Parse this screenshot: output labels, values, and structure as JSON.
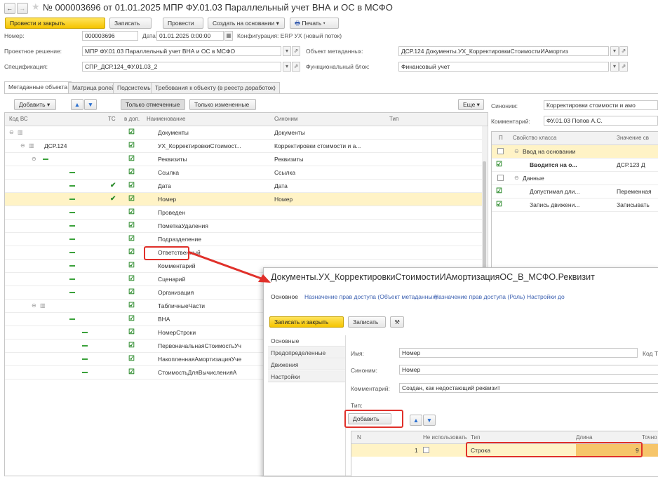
{
  "window": {
    "title": "№ 000003696 от 01.01.2025 МПР ФУ.01.03 Параллельный учет ВНА и ОС в МСФО",
    "nav_back": "←",
    "nav_forward": "→",
    "star": "★"
  },
  "toolbar": {
    "post_close": "Провести и закрыть",
    "save": "Записать",
    "post": "Провести",
    "create_based": "Создать на основании",
    "print": "Печать"
  },
  "header": {
    "number_label": "Номер:",
    "number_value": "000003696",
    "date_label": "Дата:",
    "date_value": "01.01.2025 0:00:00",
    "config_text": "Конфигурация: ERP УХ (новый поток)",
    "project_label": "Проектное решение:",
    "project_value": "МПР ФУ.01.03 Параллельный учет ВНА и ОС в МСФО",
    "meta_label": "Объект метаданных:",
    "meta_value": "ДСР.124 Документы.УХ_КорректировкиСтоимостиИАмортиз",
    "spec_label": "Спецификация:",
    "spec_value": "СПР_ДСР.124_ФУ.01.03_2",
    "func_label": "Функциональный блок:",
    "func_value": "Финансовый учет"
  },
  "tabs": [
    "Метаданные объекта",
    "Матрица ролей",
    "Подсистемы",
    "Требования к объекту (в реестр доработок)"
  ],
  "grid_toolbar": {
    "add": "Добавить",
    "only_marked": "Только отмеченные",
    "only_changed": "Только измененные",
    "more": "Еще"
  },
  "grid": {
    "headers": [
      "Код ВС",
      "ТС",
      "в доп.",
      "Наименование",
      "Синоним",
      "Тип"
    ],
    "rows": [
      {
        "code": "",
        "ts": false,
        "name": "Документы",
        "synonym": "Документы"
      },
      {
        "code": "ДСР.124",
        "ts": false,
        "name": "УХ_КорректировкиСтоимост...",
        "synonym": "Корректировки стоимости и а..."
      },
      {
        "code": "",
        "ts": false,
        "name": "Реквизиты",
        "synonym": "Реквизиты"
      },
      {
        "code": "",
        "ts": false,
        "name": "Ссылка",
        "synonym": "Ссылка"
      },
      {
        "code": "",
        "ts": true,
        "name": "Дата",
        "synonym": "Дата"
      },
      {
        "code": "",
        "ts": true,
        "name": "Номер",
        "synonym": "Номер"
      },
      {
        "code": "",
        "ts": false,
        "name": "Проведен",
        "synonym": ""
      },
      {
        "code": "",
        "ts": false,
        "name": "ПометкаУдаления",
        "synonym": ""
      },
      {
        "code": "",
        "ts": false,
        "name": "Подразделение",
        "synonym": ""
      },
      {
        "code": "",
        "ts": false,
        "name": "Ответственный",
        "synonym": ""
      },
      {
        "code": "",
        "ts": false,
        "name": "Комментарий",
        "synonym": ""
      },
      {
        "code": "",
        "ts": false,
        "name": "Сценарий",
        "synonym": ""
      },
      {
        "code": "",
        "ts": false,
        "name": "Организация",
        "synonym": ""
      },
      {
        "code": "",
        "ts": false,
        "name": "ТабличныеЧасти",
        "synonym": ""
      },
      {
        "code": "",
        "ts": false,
        "name": "ВНА",
        "synonym": ""
      },
      {
        "code": "",
        "ts": false,
        "name": "НомерСтроки",
        "synonym": ""
      },
      {
        "code": "",
        "ts": false,
        "name": "ПервоначальнаяСтоимостьУч",
        "synonym": ""
      },
      {
        "code": "",
        "ts": false,
        "name": "НакопленнаяАмортизацияУче",
        "synonym": ""
      },
      {
        "code": "",
        "ts": false,
        "name": "СтоимостьДляВычисленияА",
        "synonym": ""
      }
    ]
  },
  "right_panel": {
    "synonym_label": "Синоним:",
    "synonym_value": "Корректировки стоимости и амо",
    "comment_label": "Комментарий:",
    "comment_value": "ФУ.01.03 Попов А.С.",
    "headers": [
      "П",
      "Свойство класса",
      "Значение св"
    ],
    "rows": [
      {
        "checked": false,
        "indent": 1,
        "name": "Ввод на основании",
        "value": "",
        "bold": false
      },
      {
        "checked": true,
        "indent": 2,
        "name": "Вводится на о...",
        "value": "ДСР.123 Д",
        "bold": true
      },
      {
        "checked": false,
        "indent": 1,
        "name": "Данные",
        "value": "",
        "bold": false
      },
      {
        "checked": true,
        "indent": 2,
        "name": "Допустимая дли...",
        "value": "Переменная",
        "bold": false
      },
      {
        "checked": true,
        "indent": 2,
        "name": "Запись движени...",
        "value": "Записывать",
        "bold": false
      }
    ]
  },
  "popup": {
    "title": "Документы.УХ_КорректировкиСтоимостиИАмортизацияОС_В_МСФО.Реквизит",
    "links": [
      "Основное",
      "Назначение прав доступа (Объект метаданных)",
      "Назначение прав доступа (Роль)",
      "Настройки до"
    ],
    "save_close": "Записать и закрыть",
    "save": "Записать",
    "side_tabs": [
      "Основные",
      "Предопределенные",
      "Движения",
      "Настройки"
    ],
    "name_label": "Имя:",
    "name_value": "Номер",
    "right_label": "Код Т",
    "synonym_label": "Синоним:",
    "synonym_value": "Номер",
    "comment_label": "Комментарий:",
    "comment_value": "Создан, как недостающий реквизит",
    "type_label": "Тип:",
    "add": "Добавить",
    "type_headers": [
      "N",
      "Не использовать",
      "Тип",
      "Длина",
      "Точно"
    ],
    "type_row": {
      "n": "1",
      "type": "Строка",
      "length": "9"
    }
  },
  "colors": {
    "accent_yellow": "#f5c400",
    "highlight_row": "#fff3c6",
    "highlight_red": "#e0302a"
  }
}
